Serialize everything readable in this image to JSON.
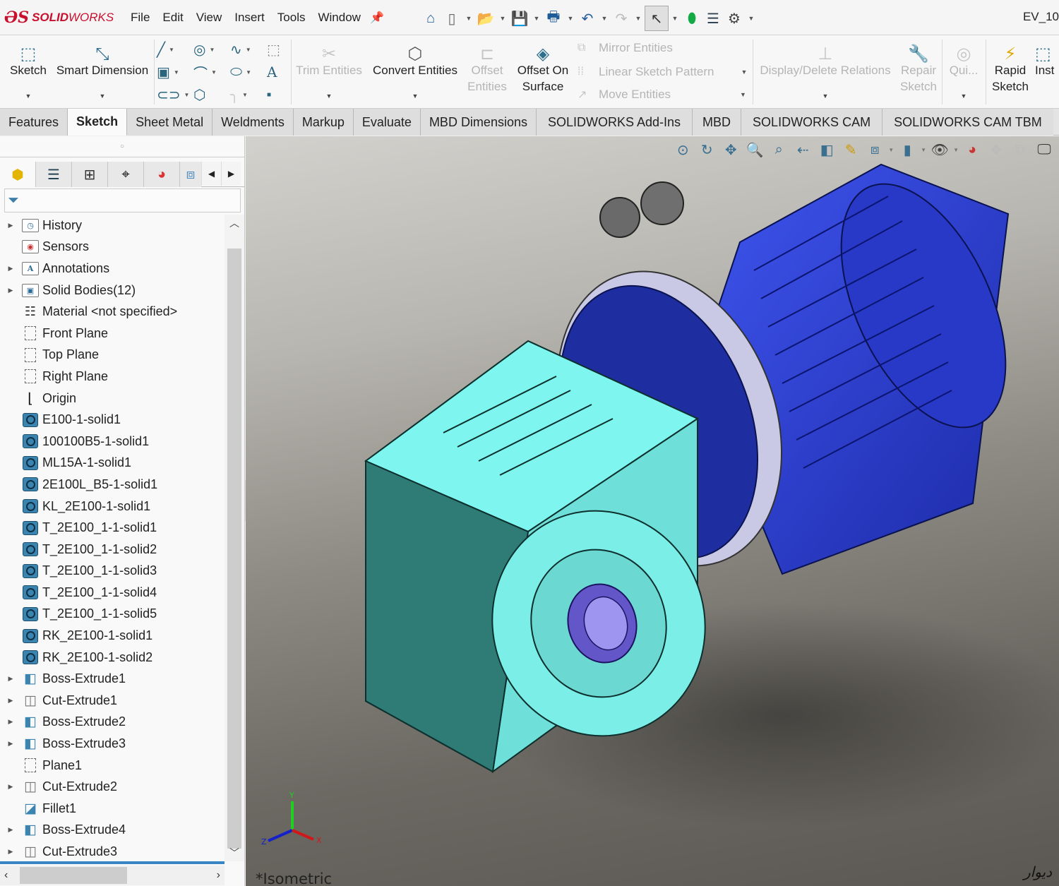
{
  "app": {
    "logo_prefix": "ƏS",
    "logo_bold": "SOLID",
    "logo_normal": "WORKS",
    "document_title": "EV_10"
  },
  "menu": [
    "File",
    "Edit",
    "View",
    "Insert",
    "Tools",
    "Window"
  ],
  "quick_access": [
    {
      "name": "home-icon",
      "glyph": "⌂"
    },
    {
      "name": "new-document-icon",
      "glyph": "🗋"
    },
    {
      "name": "open-icon",
      "glyph": "📂"
    },
    {
      "name": "save-icon",
      "glyph": "💾"
    },
    {
      "name": "print-icon",
      "glyph": "🖶"
    },
    {
      "name": "undo-icon",
      "glyph": "↶"
    },
    {
      "name": "redo-icon",
      "glyph": "↷"
    },
    {
      "name": "select-icon",
      "glyph": "↖"
    },
    {
      "name": "rebuild-icon",
      "glyph": "⬮"
    },
    {
      "name": "file-properties-icon",
      "glyph": "☰"
    },
    {
      "name": "options-icon",
      "glyph": "⚙"
    }
  ],
  "ribbon": {
    "sketch": "Sketch",
    "smart_dimension": "Smart Dimension",
    "trim_entities": "Trim Entities",
    "convert_entities": "Convert Entities",
    "offset_entities_1": "Offset",
    "offset_entities_2": "Entities",
    "offset_on_surface_1": "Offset On",
    "offset_on_surface_2": "Surface",
    "mirror_entities": "Mirror Entities",
    "linear_sketch_pattern": "Linear Sketch Pattern",
    "move_entities": "Move Entities",
    "display_delete_relations": "Display/Delete Relations",
    "repair_sketch_1": "Repair",
    "repair_sketch_2": "Sketch",
    "quick_snaps": "Qui...",
    "rapid_sketch_1": "Rapid",
    "rapid_sketch_2": "Sketch",
    "instant2d": "Inst"
  },
  "command_tabs": [
    {
      "label": "Features",
      "active": false
    },
    {
      "label": "Sketch",
      "active": true
    },
    {
      "label": "Sheet Metal",
      "active": false
    },
    {
      "label": "Weldments",
      "active": false
    },
    {
      "label": "Markup",
      "active": false
    },
    {
      "label": "Evaluate",
      "active": false
    },
    {
      "label": "MBD Dimensions",
      "active": false
    },
    {
      "label": "SOLIDWORKS Add-Ins",
      "active": false
    },
    {
      "label": "MBD",
      "active": false
    },
    {
      "label": "SOLIDWORKS CAM",
      "active": false
    },
    {
      "label": "SOLIDWORKS CAM TBM",
      "active": false
    }
  ],
  "feature_tree": {
    "items": [
      {
        "label": "History",
        "icon": "history",
        "expandable": true
      },
      {
        "label": "Sensors",
        "icon": "sensors",
        "expandable": false
      },
      {
        "label": "Annotations",
        "icon": "annotations",
        "expandable": true
      },
      {
        "label": "Solid Bodies(12)",
        "icon": "solid-bodies",
        "expandable": true
      },
      {
        "label": "Material <not specified>",
        "icon": "material",
        "expandable": false
      },
      {
        "label": "Front Plane",
        "icon": "plane",
        "expandable": false
      },
      {
        "label": "Top Plane",
        "icon": "plane",
        "expandable": false
      },
      {
        "label": "Right Plane",
        "icon": "plane",
        "expandable": false
      },
      {
        "label": "Origin",
        "icon": "origin",
        "expandable": false
      },
      {
        "label": "E100-1-solid1",
        "icon": "body",
        "expandable": false
      },
      {
        "label": "100100B5-1-solid1",
        "icon": "body",
        "expandable": false
      },
      {
        "label": "ML15A-1-solid1",
        "icon": "body",
        "expandable": false
      },
      {
        "label": "2E100L_B5-1-solid1",
        "icon": "body",
        "expandable": false
      },
      {
        "label": "KL_2E100-1-solid1",
        "icon": "body",
        "expandable": false
      },
      {
        "label": "T_2E100_1-1-solid1",
        "icon": "body",
        "expandable": false
      },
      {
        "label": "T_2E100_1-1-solid2",
        "icon": "body",
        "expandable": false
      },
      {
        "label": "T_2E100_1-1-solid3",
        "icon": "body",
        "expandable": false
      },
      {
        "label": "T_2E100_1-1-solid4",
        "icon": "body",
        "expandable": false
      },
      {
        "label": "T_2E100_1-1-solid5",
        "icon": "body",
        "expandable": false
      },
      {
        "label": "RK_2E100-1-solid1",
        "icon": "body",
        "expandable": false
      },
      {
        "label": "RK_2E100-1-solid2",
        "icon": "body",
        "expandable": false
      },
      {
        "label": "Boss-Extrude1",
        "icon": "boss-extrude",
        "expandable": true
      },
      {
        "label": "Cut-Extrude1",
        "icon": "cut-extrude",
        "expandable": true
      },
      {
        "label": "Boss-Extrude2",
        "icon": "boss-extrude",
        "expandable": true
      },
      {
        "label": "Boss-Extrude3",
        "icon": "boss-extrude",
        "expandable": true
      },
      {
        "label": "Plane1",
        "icon": "plane",
        "expandable": false
      },
      {
        "label": "Cut-Extrude2",
        "icon": "cut-extrude",
        "expandable": true
      },
      {
        "label": "Fillet1",
        "icon": "fillet",
        "expandable": false
      },
      {
        "label": "Boss-Extrude4",
        "icon": "boss-extrude",
        "expandable": true
      },
      {
        "label": "Cut-Extrude3",
        "icon": "cut-extrude",
        "expandable": true
      }
    ]
  },
  "viewport": {
    "view_name": "*Isometric",
    "watermark": "دیوار",
    "triad": {
      "y": "Y",
      "z": "Z",
      "x": "X"
    },
    "colors": {
      "gearbox": "#7ff5ef",
      "motor": "#2f3fd6",
      "flange_ring": "#c9c9e6",
      "shaft": "#7c74e0"
    }
  }
}
